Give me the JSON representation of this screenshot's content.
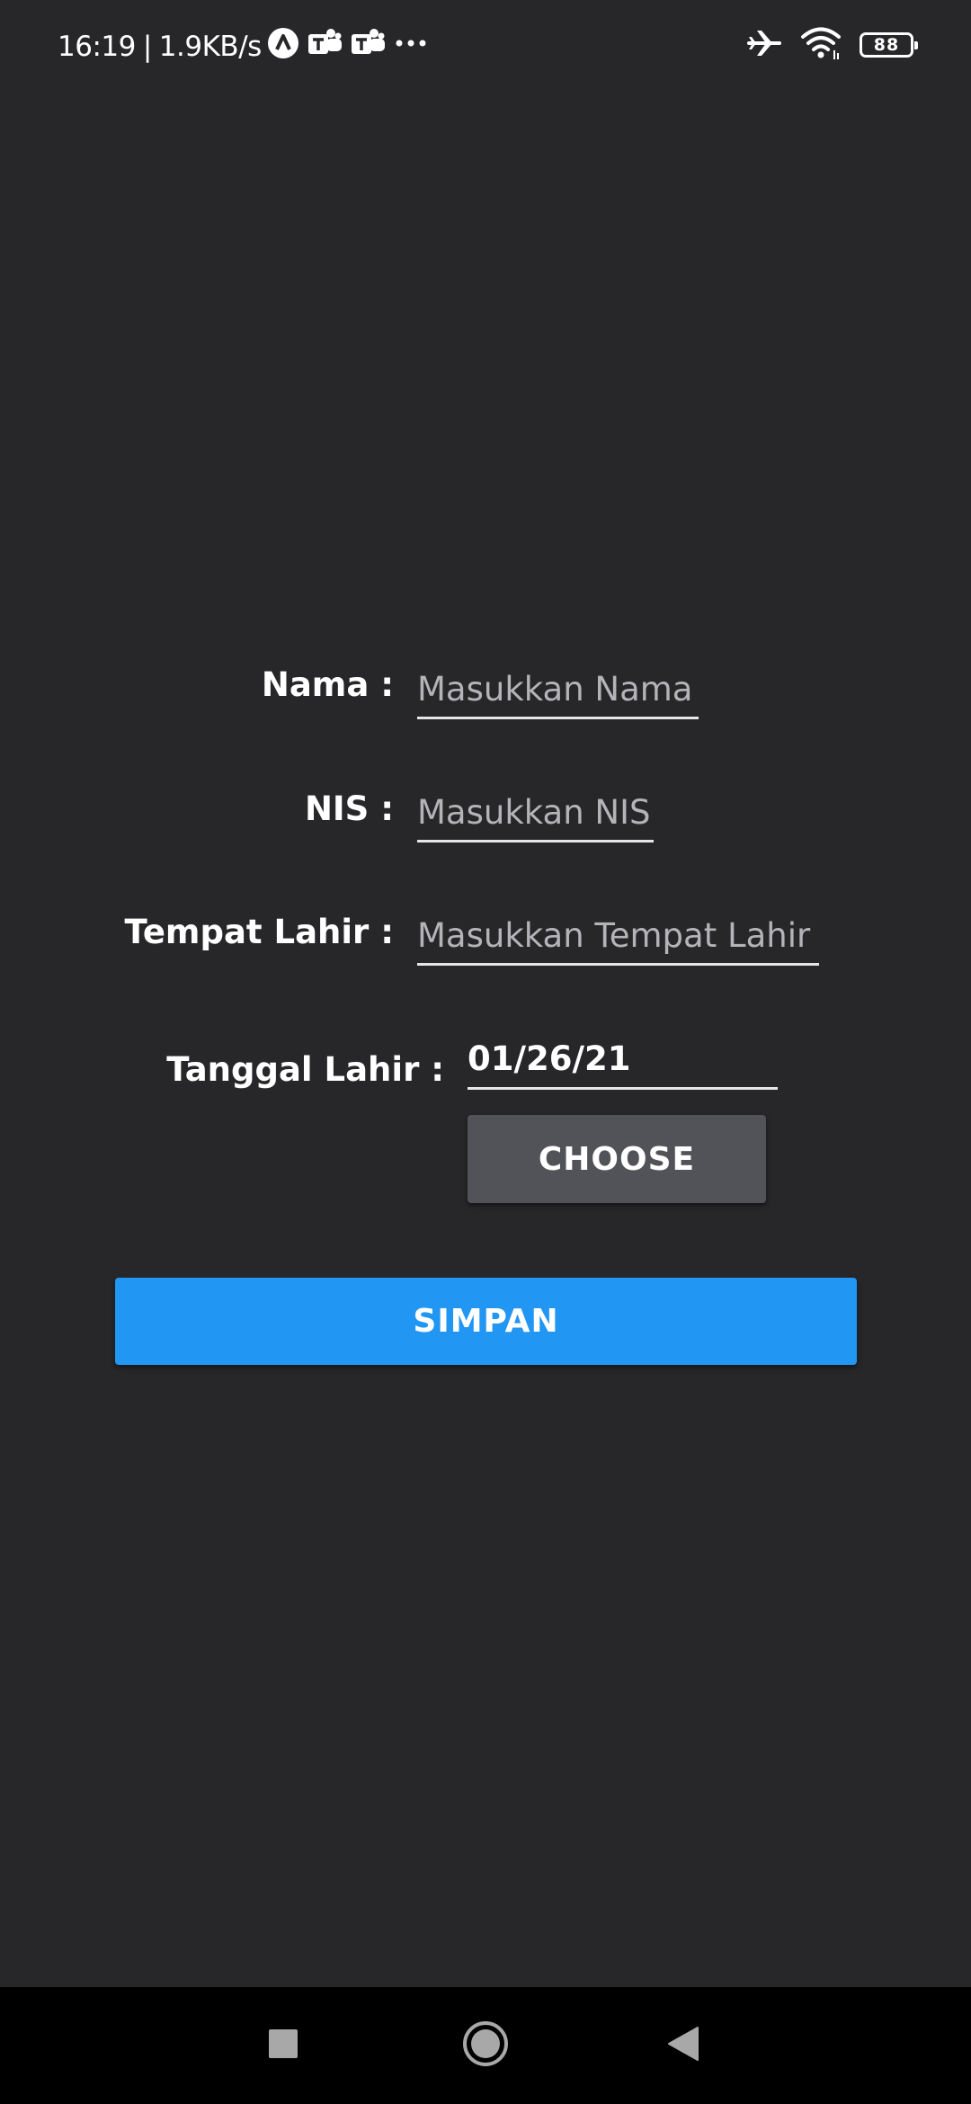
{
  "status_bar": {
    "time": "16:19",
    "separator": "|",
    "network_speed": "1.9KB/s",
    "left_icons": [
      "app-a-icon",
      "teams-icon",
      "teams-icon",
      "more-dots-icon"
    ],
    "right_icons": [
      "airplane-mode-icon",
      "wifi-icon",
      "battery-icon"
    ],
    "battery_level": "88"
  },
  "form": {
    "nama": {
      "label": "Nama :",
      "placeholder": "Masukkan Nama",
      "value": ""
    },
    "nis": {
      "label": "NIS :",
      "placeholder": "Masukkan NIS",
      "value": ""
    },
    "tempat_lahir": {
      "label": "Tempat Lahir :",
      "placeholder": "Masukkan Tempat Lahir",
      "value": ""
    },
    "tanggal_lahir": {
      "label": "Tanggal Lahir :",
      "value": "01/26/21"
    },
    "choose_label": "CHOOSE",
    "simpan_label": "SIMPAN"
  },
  "nav_bar": {
    "buttons": [
      "recents-square-icon",
      "home-circle-icon",
      "back-triangle-icon"
    ]
  },
  "colors": {
    "background": "#27272a",
    "primary_button": "#2196f3",
    "secondary_button": "#525259",
    "nav_background": "#000000"
  }
}
